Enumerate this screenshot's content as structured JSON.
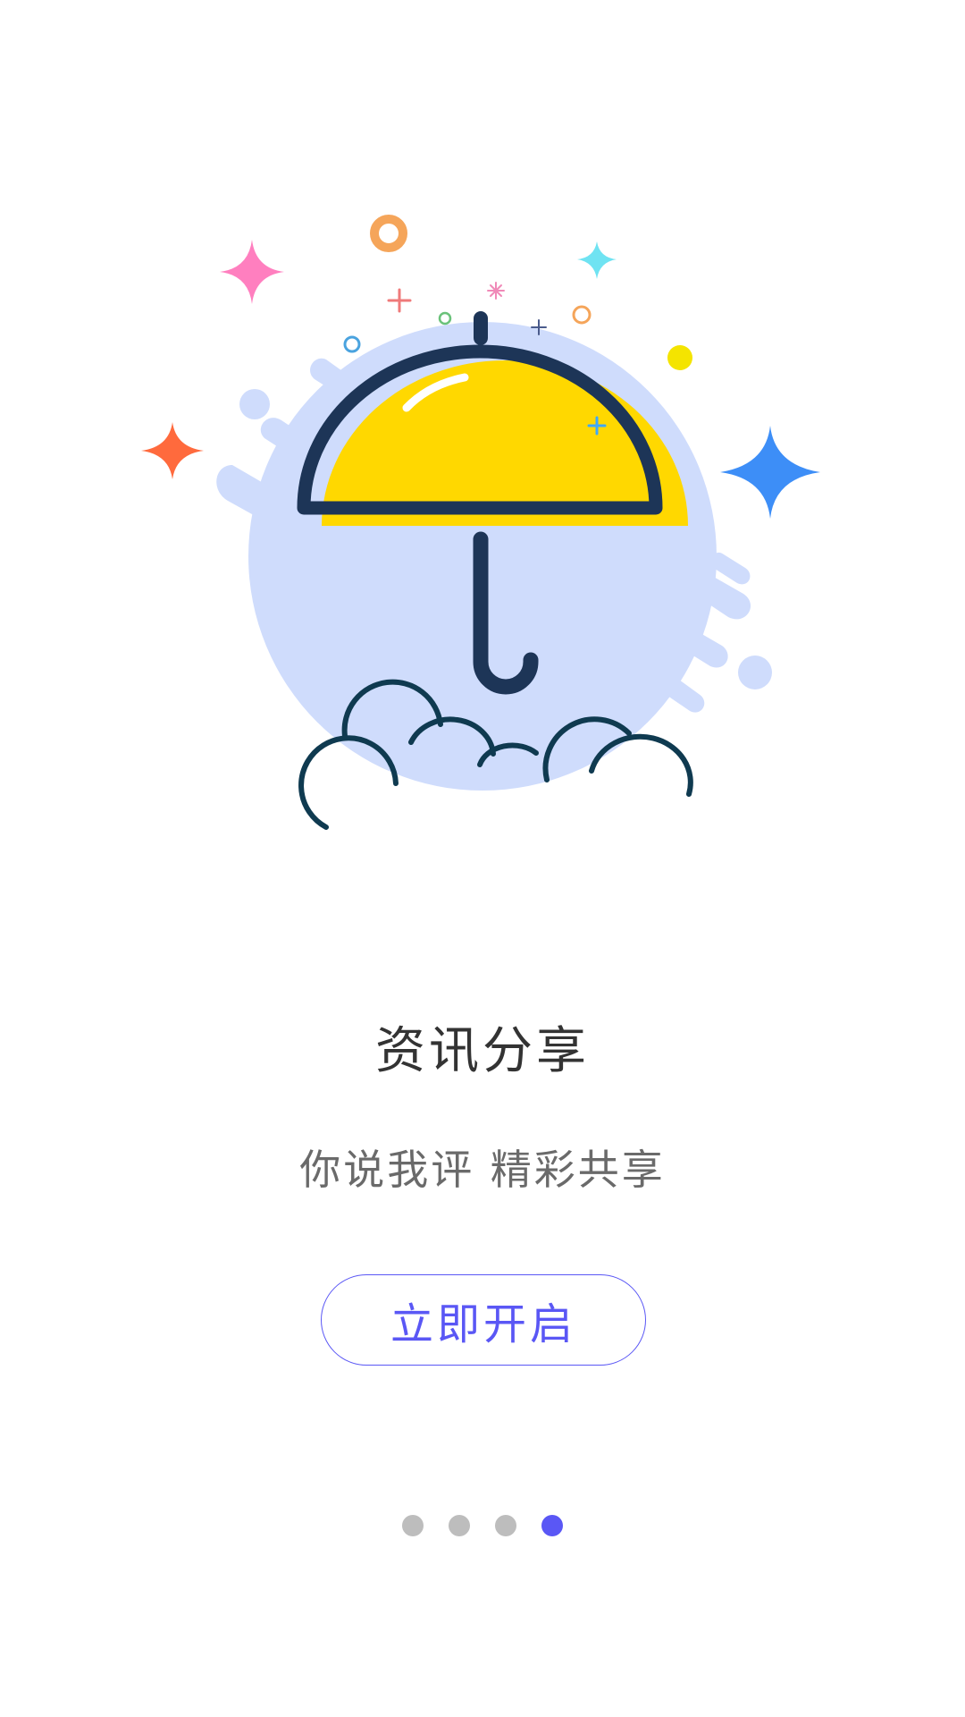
{
  "onboarding": {
    "title": "资讯分享",
    "subtitle": "你说我评 精彩共享",
    "start_button_label": "立即开启",
    "page_count": 4,
    "current_page": 4,
    "illustration": "umbrella-over-clouds-illustration"
  },
  "colors": {
    "accent": "#5a57f5",
    "dot_inactive": "#bdbdbd",
    "umbrella_yellow": "#ffd800",
    "umbrella_outline": "#1d3557",
    "backdrop_blue": "#cfdcfc"
  }
}
